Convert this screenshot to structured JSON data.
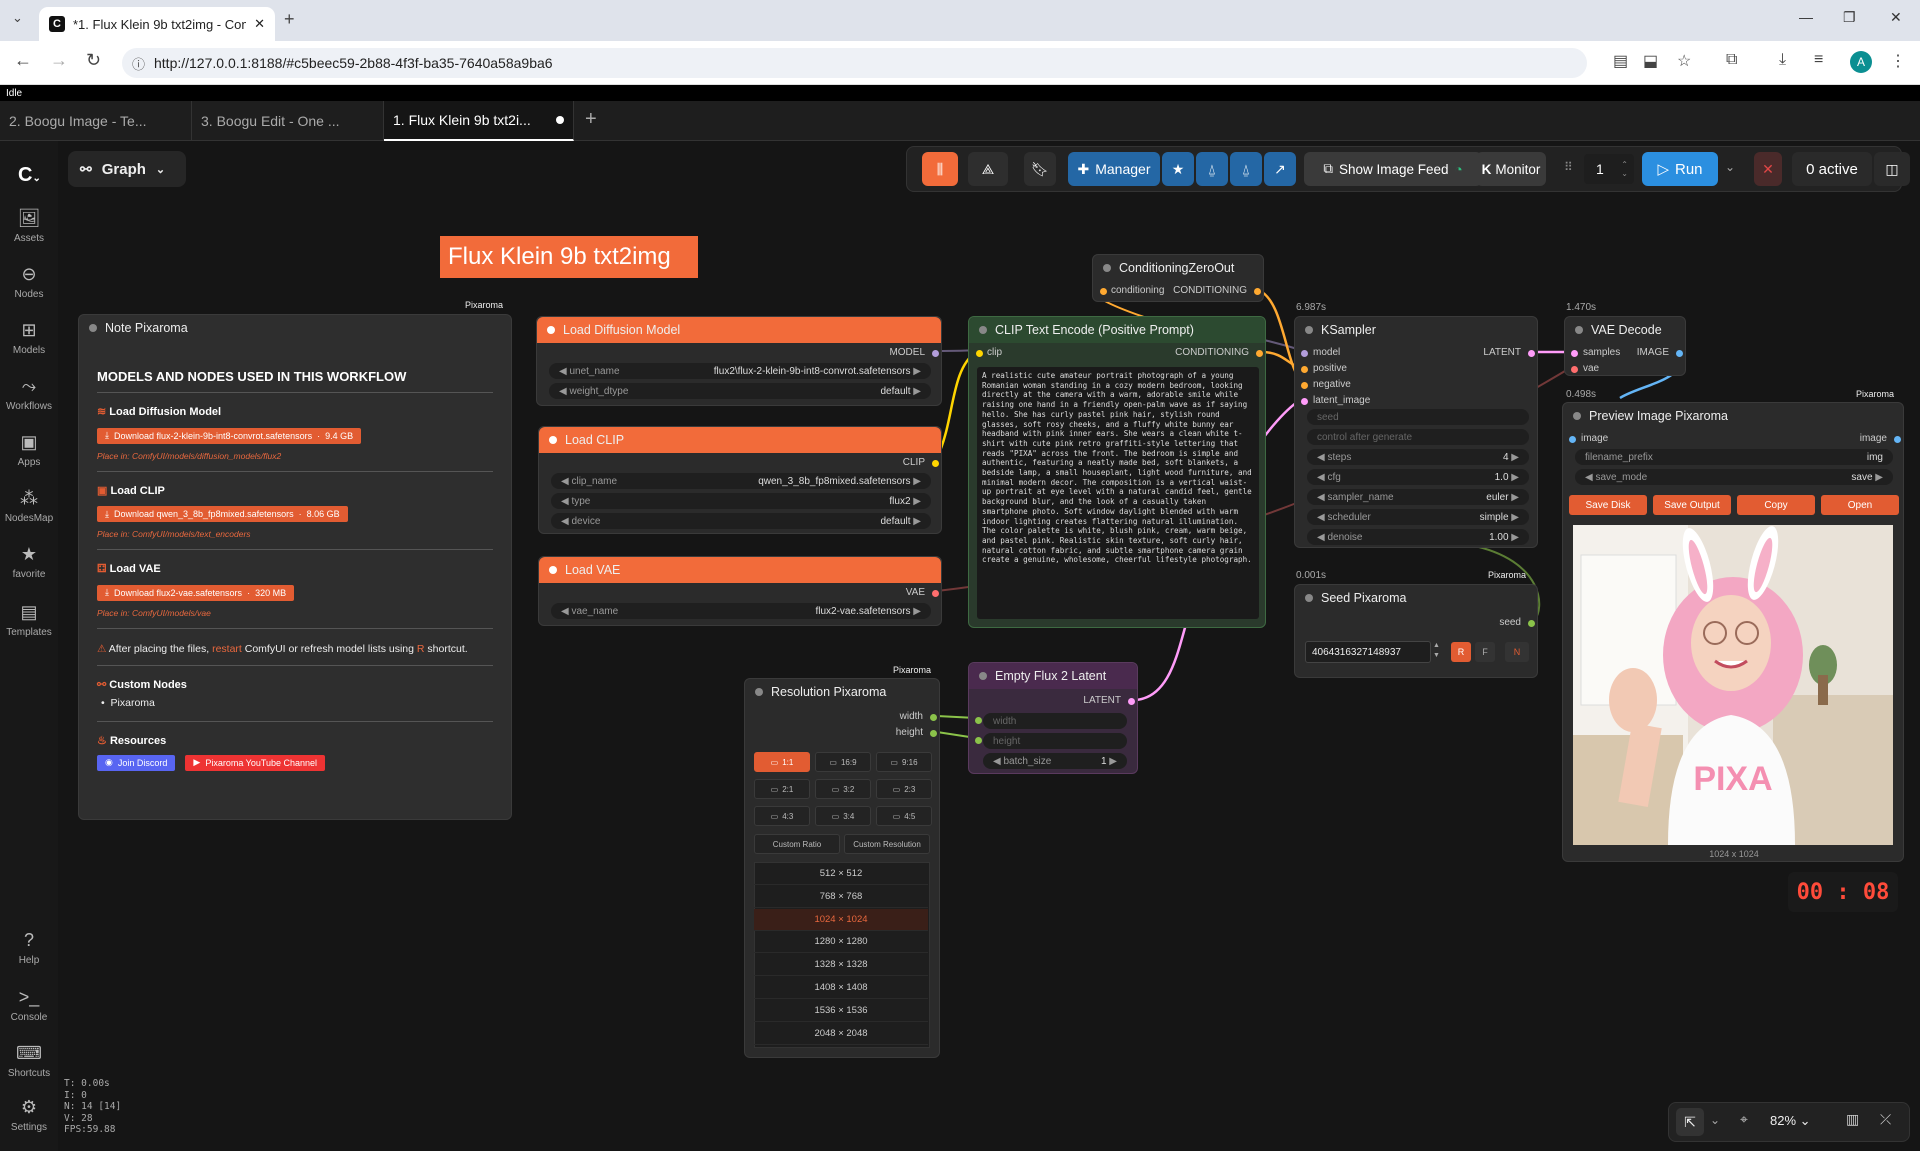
{
  "browser": {
    "tab_title": "*1. Flux Klein 9b txt2img - Com",
    "url": "http://127.0.0.1:8188/#c5beec59-2b88-4f3f-ba35-7640a58a9ba6",
    "avatar": "A",
    "new_tab": "+",
    "fav": "C"
  },
  "status": "Idle",
  "workflow_tabs": [
    "2. Boogu Image - Te...",
    "3. Boogu Edit - One ...",
    "1. Flux Klein 9b txt2i..."
  ],
  "sidebar": [
    {
      "label": "Assets",
      "icon": "🖼"
    },
    {
      "label": "Nodes",
      "icon": "⊖"
    },
    {
      "label": "Models",
      "icon": "⊞"
    },
    {
      "label": "Workflows",
      "icon": "⤳"
    },
    {
      "label": "Apps",
      "icon": "▣"
    },
    {
      "label": "NodesMap",
      "icon": "⁂"
    },
    {
      "label": "favorite",
      "icon": "★"
    },
    {
      "label": "Templates",
      "icon": "▤"
    }
  ],
  "sidebar_bottom": [
    {
      "label": "Help",
      "icon": "?"
    },
    {
      "label": "Console",
      "icon": ">_"
    },
    {
      "label": "Shortcuts",
      "icon": "⌨"
    },
    {
      "label": "Settings",
      "icon": "⚙"
    }
  ],
  "graph_label": "Graph",
  "toolbar": {
    "manager": "Manager",
    "show_feed": "Show Image Feed",
    "monitor": "Monitor",
    "batch": "1",
    "run": "Run",
    "active": "0 active"
  },
  "title_note": "Flux Klein 9b txt2img",
  "note": {
    "title": "Note Pixaroma",
    "badge": "Pixaroma",
    "heading": "MODELS AND NODES USED IN THIS WORKFLOW",
    "sections": [
      {
        "name": "Load Diffusion Model",
        "download": "Download flux-2-klein-9b-int8-convrot.safetensors",
        "size": "9.4 GB",
        "place": "Place in: ComfyUI/models/diffusion_models/flux2"
      },
      {
        "name": "Load CLIP",
        "download": "Download qwen_3_8b_fp8mixed.safetensors",
        "size": "8.06 GB",
        "place": "Place in: ComfyUI/models/text_encoders"
      },
      {
        "name": "Load VAE",
        "download": "Download flux2-vae.safetensors",
        "size": "320 MB",
        "place": "Place in: ComfyUI/models/vae"
      }
    ],
    "warning_a": "After placing the files, ",
    "warning_b": "restart",
    "warning_c": " ComfyUI or refresh model lists using ",
    "warning_d": "R",
    "warning_e": " shortcut.",
    "custom_nodes": "Custom Nodes",
    "custom_item": "Pixaroma",
    "resources": "Resources",
    "discord": "Join Discord",
    "youtube": "Pixaroma YouTube Channel"
  },
  "load_model": {
    "title": "Load Diffusion Model",
    "out": "MODEL",
    "unet_name": "unet_name",
    "unet_val": "flux2\\flux-2-klein-9b-int8-convrot.safetensors",
    "dtype": "weight_dtype",
    "dtype_val": "default"
  },
  "load_clip": {
    "title": "Load CLIP",
    "out": "CLIP",
    "clip_name": "clip_name",
    "clip_val": "qwen_3_8b_fp8mixed.safetensors",
    "type": "type",
    "type_val": "flux2",
    "device": "device",
    "device_val": "default"
  },
  "load_vae": {
    "title": "Load VAE",
    "out": "VAE",
    "vae_name": "vae_name",
    "vae_val": "flux2-vae.safetensors"
  },
  "clip_encode": {
    "title": "CLIP Text Encode (Positive Prompt)",
    "in": "clip",
    "out": "CONDITIONING",
    "prompt": "A realistic cute amateur portrait photograph of a young Romanian woman standing in a cozy modern bedroom, looking directly at the camera with a warm, adorable smile while raising one hand in a friendly open-palm wave as if saying hello. She has curly pastel pink hair, stylish round glasses, soft rosy cheeks, and a fluffy white bunny ear headband with pink inner ears. She wears a clean white t-shirt with cute pink retro graffiti-style lettering that reads \"PIXA\" across the front. The bedroom is simple and authentic, featuring a neatly made bed, soft blankets, a bedside lamp, a small houseplant, light wood furniture, and minimal modern decor. The composition is a vertical waist-up portrait at eye level with a natural candid feel, gentle background blur, and the look of a casually taken smartphone photo. Soft window daylight blended with warm indoor lighting creates flattering natural illumination. The color palette is white, blush pink, cream, warm beige, and pastel pink. Realistic skin texture, soft curly hair, natural cotton fabric, and subtle smartphone camera grain create a genuine, wholesome, cheerful lifestyle photograph."
  },
  "cond_zero": {
    "title": "ConditioningZeroOut",
    "in": "conditioning",
    "out": "CONDITIONING"
  },
  "ksampler": {
    "title": "KSampler",
    "timing": "6.987s",
    "inputs": [
      "model",
      "positive",
      "negative",
      "latent_image"
    ],
    "out": "LATENT",
    "seed": "seed",
    "control": "control after generate",
    "steps": "steps",
    "steps_val": "4",
    "cfg": "cfg",
    "cfg_val": "1.0",
    "sampler": "sampler_name",
    "sampler_val": "euler",
    "scheduler": "scheduler",
    "scheduler_val": "simple",
    "denoise": "denoise",
    "denoise_val": "1.00"
  },
  "vae_decode": {
    "title": "VAE Decode",
    "timing": "1.470s",
    "in1": "samples",
    "in2": "vae",
    "out": "IMAGE"
  },
  "preview": {
    "title": "Preview Image Pixaroma",
    "timing": "0.498s",
    "badge": "Pixaroma",
    "in": "image",
    "out": "image",
    "prefix": "filename_prefix",
    "prefix_val": "img",
    "save_mode": "save_mode",
    "save_val": "save",
    "btn_disk": "Save Disk",
    "btn_output": "Save Output",
    "btn_copy": "Copy",
    "btn_open": "Open",
    "size": "1024 x 1024",
    "shirt": "PIXA"
  },
  "seed_node": {
    "title": "Seed Pixaroma",
    "timing": "0.001s",
    "badge": "Pixaroma",
    "out": "seed",
    "value": "40643163271489​37",
    "r": "R",
    "f": "F",
    "n": "N"
  },
  "resolution": {
    "title": "Resolution Pixaroma",
    "badge": "Pixaroma",
    "out1": "width",
    "out2": "height",
    "ratios": [
      "1:1",
      "16:9",
      "9:16",
      "2:1",
      "3:2",
      "2:3",
      "4:3",
      "3:4",
      "4:5"
    ],
    "custom_ratio": "Custom Ratio",
    "custom_res": "Custom Resolution",
    "sizes": [
      "512 × 512",
      "768 × 768",
      "1024 × 1024",
      "1280 × 1280",
      "1328 × 1328",
      "1408 × 1408",
      "1536 × 1536",
      "2048 × 2048"
    ],
    "selected": "1024 × 1024"
  },
  "empty_latent": {
    "title": "Empty Flux 2 Latent",
    "out": "LATENT",
    "w": "width",
    "h": "height",
    "batch": "batch_size",
    "batch_val": "1"
  },
  "timer": "00 : 08",
  "stats": {
    "t": "T: 0.00s",
    "i": "I: 0",
    "n": "N: 14 [14]",
    "v": "V: 28",
    "fps": "FPS:59.88"
  },
  "zoom": "82%"
}
